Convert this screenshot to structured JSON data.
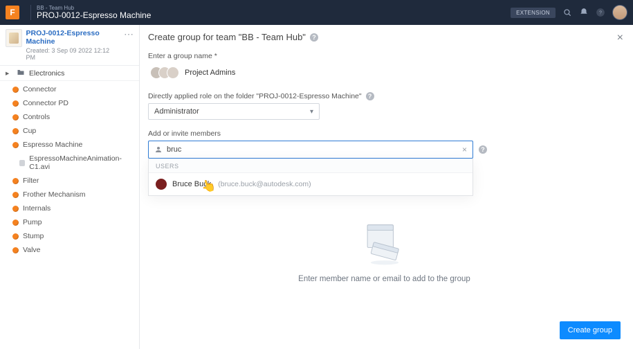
{
  "topbar": {
    "logo_letter": "F",
    "eyebrow": "BB - Team Hub",
    "title": "PROJ-0012-Espresso Machine",
    "badge": "EXTENSION"
  },
  "sidebar": {
    "project_title": "PROJ-0012-Espresso Machine",
    "project_meta": "Created: 3   Sep 09 2022 12:12 PM",
    "root_label": "Electronics",
    "items": [
      {
        "kind": "orange",
        "label": "Connector"
      },
      {
        "kind": "orange",
        "label": "Connector PD"
      },
      {
        "kind": "orange",
        "label": "Controls"
      },
      {
        "kind": "orange",
        "label": "Cup"
      },
      {
        "kind": "orange",
        "label": "Espresso Machine"
      },
      {
        "kind": "neutral",
        "label": "EspressoMachineAnimation-C1.avi",
        "indent": true
      },
      {
        "kind": "orange",
        "label": "Filter"
      },
      {
        "kind": "orange",
        "label": "Frother Mechanism"
      },
      {
        "kind": "orange",
        "label": "Internals"
      },
      {
        "kind": "orange",
        "label": "Pump"
      },
      {
        "kind": "orange",
        "label": "Stump"
      },
      {
        "kind": "orange",
        "label": "Valve"
      }
    ]
  },
  "panel": {
    "heading": "Create group for team \"BB - Team Hub\"",
    "group_name_label": "Enter a group name *",
    "group_name_value": "Project Admins",
    "role_label": "Directly applied role on the folder \"PROJ-0012-Espresso Machine\"",
    "role_value": "Administrator",
    "members_label": "Add or invite members",
    "search_value": "bruc",
    "dropdown_section": "Users",
    "suggestion_name": "Bruce Buck",
    "suggestion_email": "(bruce.buck@autodesk.com)",
    "empty_text": "Enter member name or email to add to the group",
    "create_label": "Create group"
  }
}
